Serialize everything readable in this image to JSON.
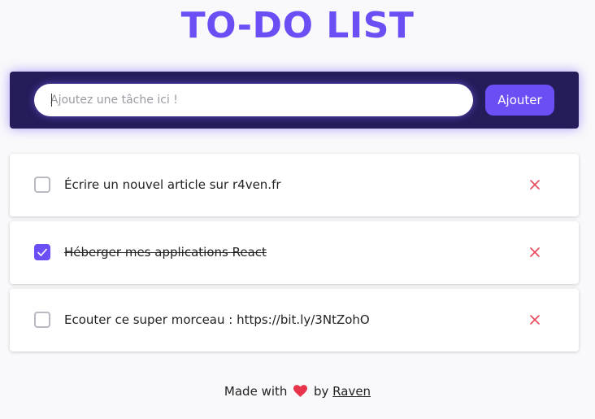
{
  "header": {
    "title": "TO-DO LIST"
  },
  "input_panel": {
    "placeholder": "Ajoutez une tâche ici !",
    "value": "",
    "add_label": "Ajouter"
  },
  "tasks": [
    {
      "text": "Écrire un nouvel article sur r4ven.fr",
      "done": false
    },
    {
      "text": "Héberger mes applications React",
      "done": true
    },
    {
      "text": "Ecouter ce super morceau : https://bit.ly/3NtZohO",
      "done": false
    }
  ],
  "footer": {
    "prefix": "Made with",
    "heart_icon": "heart-icon",
    "middle": "by",
    "author": "Raven"
  },
  "colors": {
    "accent": "#6c4ef5",
    "panel": "#251c5a",
    "delete": "#e8485b",
    "heart": "#e8344a"
  }
}
